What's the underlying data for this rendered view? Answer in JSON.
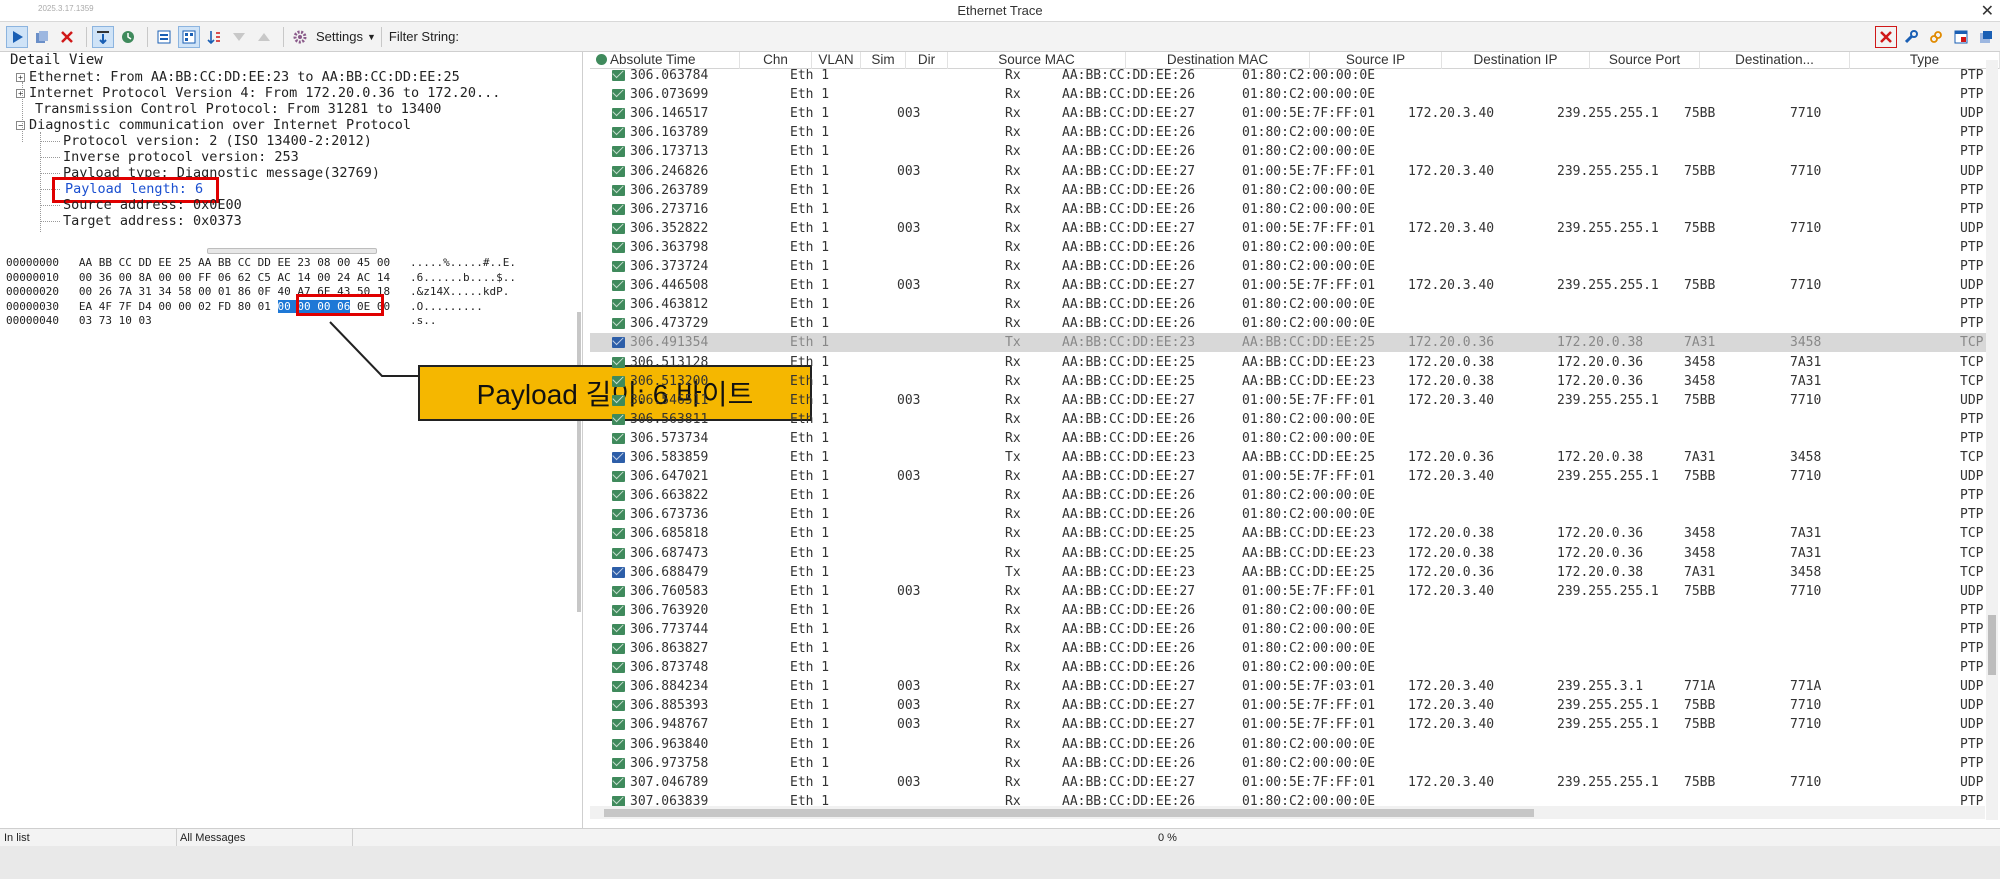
{
  "window": {
    "version": "2025.3.17.1359",
    "title": "Ethernet Trace",
    "close_glyph": "✕"
  },
  "toolbar": {
    "settings_label": "Settings",
    "filter_label": "Filter String:"
  },
  "detail": {
    "header": "Detail View",
    "lines": [
      "Ethernet: From AA:BB:CC:DD:EE:23 to AA:BB:CC:DD:EE:25",
      "Internet Protocol Version 4: From 172.20.0.36 to 172.20...",
      "Transmission Control Protocol: From 31281 to 13400",
      "Diagnostic communication over Internet Protocol",
      "Protocol version: 2 (ISO 13400-2:2012)",
      "Inverse protocol version: 253",
      "Payload type: Diagnostic message(32769)",
      "Payload length: 6",
      "Source address: 0x0E00",
      "Target address: 0x0373"
    ]
  },
  "hex": {
    "rows": [
      {
        "offset": "00000000",
        "bytes": "AA BB CC DD EE 25 AA BB CC DD EE 23 08 00 45 00",
        "ascii": ".....%.....#..E."
      },
      {
        "offset": "00000010",
        "bytes": "00 36 00 8A 00 00 FF 06 62 C5 AC 14 00 24 AC 14",
        "ascii": ".6......b....$.."
      },
      {
        "offset": "00000020",
        "bytes": "00 26 7A 31 34 58 00 01 86 0F 40 A7 6E 43 50 18",
        "ascii": ".&z14X.....kdP."
      },
      {
        "offset": "00000030",
        "bytes_pre": "EA 4F 7F D4 00 00 02 FD 80 01 ",
        "bytes_sel": "00 00 00 06",
        "bytes_post": " 0E 00",
        "ascii": ".O........."
      },
      {
        "offset": "00000040",
        "bytes": "03 73 10 03",
        "ascii": ".s.."
      }
    ]
  },
  "callout": {
    "text": "Payload 길이: 6 바이트"
  },
  "colors": {
    "rx_icon": "#3f8a5c",
    "tx_icon": "#2d5ea8",
    "highlight_red": "#e00000",
    "callout_bg": "#f5b700"
  },
  "table": {
    "columns": [
      "Absolute Time",
      "Chn",
      "VLAN",
      "Sim",
      "Dir",
      "Source MAC",
      "Destination MAC",
      "Source IP",
      "Destination IP",
      "Source Port",
      "Destination...",
      "Type"
    ],
    "rows": [
      [
        "306.063784",
        "Eth 1",
        "",
        "",
        "Rx",
        "AA:BB:CC:DD:EE:26",
        "01:80:C2:00:00:0E",
        "",
        "",
        "",
        "",
        "PTP"
      ],
      [
        "306.073699",
        "Eth 1",
        "",
        "",
        "Rx",
        "AA:BB:CC:DD:EE:26",
        "01:80:C2:00:00:0E",
        "",
        "",
        "",
        "",
        "PTP"
      ],
      [
        "306.146517",
        "Eth 1",
        "003",
        "",
        "Rx",
        "AA:BB:CC:DD:EE:27",
        "01:00:5E:7F:FF:01",
        "172.20.3.40",
        "239.255.255.1",
        "75BB",
        "7710",
        "UDP"
      ],
      [
        "306.163789",
        "Eth 1",
        "",
        "",
        "Rx",
        "AA:BB:CC:DD:EE:26",
        "01:80:C2:00:00:0E",
        "",
        "",
        "",
        "",
        "PTP"
      ],
      [
        "306.173713",
        "Eth 1",
        "",
        "",
        "Rx",
        "AA:BB:CC:DD:EE:26",
        "01:80:C2:00:00:0E",
        "",
        "",
        "",
        "",
        "PTP"
      ],
      [
        "306.246826",
        "Eth 1",
        "003",
        "",
        "Rx",
        "AA:BB:CC:DD:EE:27",
        "01:00:5E:7F:FF:01",
        "172.20.3.40",
        "239.255.255.1",
        "75BB",
        "7710",
        "UDP"
      ],
      [
        "306.263789",
        "Eth 1",
        "",
        "",
        "Rx",
        "AA:BB:CC:DD:EE:26",
        "01:80:C2:00:00:0E",
        "",
        "",
        "",
        "",
        "PTP"
      ],
      [
        "306.273716",
        "Eth 1",
        "",
        "",
        "Rx",
        "AA:BB:CC:DD:EE:26",
        "01:80:C2:00:00:0E",
        "",
        "",
        "",
        "",
        "PTP"
      ],
      [
        "306.352822",
        "Eth 1",
        "003",
        "",
        "Rx",
        "AA:BB:CC:DD:EE:27",
        "01:00:5E:7F:FF:01",
        "172.20.3.40",
        "239.255.255.1",
        "75BB",
        "7710",
        "UDP"
      ],
      [
        "306.363798",
        "Eth 1",
        "",
        "",
        "Rx",
        "AA:BB:CC:DD:EE:26",
        "01:80:C2:00:00:0E",
        "",
        "",
        "",
        "",
        "PTP"
      ],
      [
        "306.373724",
        "Eth 1",
        "",
        "",
        "Rx",
        "AA:BB:CC:DD:EE:26",
        "01:80:C2:00:00:0E",
        "",
        "",
        "",
        "",
        "PTP"
      ],
      [
        "306.446508",
        "Eth 1",
        "003",
        "",
        "Rx",
        "AA:BB:CC:DD:EE:27",
        "01:00:5E:7F:FF:01",
        "172.20.3.40",
        "239.255.255.1",
        "75BB",
        "7710",
        "UDP"
      ],
      [
        "306.463812",
        "Eth 1",
        "",
        "",
        "Rx",
        "AA:BB:CC:DD:EE:26",
        "01:80:C2:00:00:0E",
        "",
        "",
        "",
        "",
        "PTP"
      ],
      [
        "306.473729",
        "Eth 1",
        "",
        "",
        "Rx",
        "AA:BB:CC:DD:EE:26",
        "01:80:C2:00:00:0E",
        "",
        "",
        "",
        "",
        "PTP"
      ],
      [
        "306.491354",
        "Eth 1",
        "",
        "",
        "Tx",
        "AA:BB:CC:DD:EE:23",
        "AA:BB:CC:DD:EE:25",
        "172.20.0.36",
        "172.20.0.38",
        "7A31",
        "3458",
        "TCP"
      ],
      [
        "306.513128",
        "Eth 1",
        "",
        "",
        "Rx",
        "AA:BB:CC:DD:EE:25",
        "AA:BB:CC:DD:EE:23",
        "172.20.0.38",
        "172.20.0.36",
        "3458",
        "7A31",
        "TCP"
      ],
      [
        "306.513200",
        "Eth 1",
        "",
        "",
        "Rx",
        "AA:BB:CC:DD:EE:25",
        "AA:BB:CC:DD:EE:23",
        "172.20.0.38",
        "172.20.0.36",
        "3458",
        "7A31",
        "TCP"
      ],
      [
        "306.546511",
        "Eth 1",
        "003",
        "",
        "Rx",
        "AA:BB:CC:DD:EE:27",
        "01:00:5E:7F:FF:01",
        "172.20.3.40",
        "239.255.255.1",
        "75BB",
        "7710",
        "UDP"
      ],
      [
        "306.563811",
        "Eth 1",
        "",
        "",
        "Rx",
        "AA:BB:CC:DD:EE:26",
        "01:80:C2:00:00:0E",
        "",
        "",
        "",
        "",
        "PTP"
      ],
      [
        "306.573734",
        "Eth 1",
        "",
        "",
        "Rx",
        "AA:BB:CC:DD:EE:26",
        "01:80:C2:00:00:0E",
        "",
        "",
        "",
        "",
        "PTP"
      ],
      [
        "306.583859",
        "Eth 1",
        "",
        "",
        "Tx",
        "AA:BB:CC:DD:EE:23",
        "AA:BB:CC:DD:EE:25",
        "172.20.0.36",
        "172.20.0.38",
        "7A31",
        "3458",
        "TCP"
      ],
      [
        "306.647021",
        "Eth 1",
        "003",
        "",
        "Rx",
        "AA:BB:CC:DD:EE:27",
        "01:00:5E:7F:FF:01",
        "172.20.3.40",
        "239.255.255.1",
        "75BB",
        "7710",
        "UDP"
      ],
      [
        "306.663822",
        "Eth 1",
        "",
        "",
        "Rx",
        "AA:BB:CC:DD:EE:26",
        "01:80:C2:00:00:0E",
        "",
        "",
        "",
        "",
        "PTP"
      ],
      [
        "306.673736",
        "Eth 1",
        "",
        "",
        "Rx",
        "AA:BB:CC:DD:EE:26",
        "01:80:C2:00:00:0E",
        "",
        "",
        "",
        "",
        "PTP"
      ],
      [
        "306.685818",
        "Eth 1",
        "",
        "",
        "Rx",
        "AA:BB:CC:DD:EE:25",
        "AA:BB:CC:DD:EE:23",
        "172.20.0.38",
        "172.20.0.36",
        "3458",
        "7A31",
        "TCP"
      ],
      [
        "306.687473",
        "Eth 1",
        "",
        "",
        "Rx",
        "AA:BB:CC:DD:EE:25",
        "AA:BB:CC:DD:EE:23",
        "172.20.0.38",
        "172.20.0.36",
        "3458",
        "7A31",
        "TCP"
      ],
      [
        "306.688479",
        "Eth 1",
        "",
        "",
        "Tx",
        "AA:BB:CC:DD:EE:23",
        "AA:BB:CC:DD:EE:25",
        "172.20.0.36",
        "172.20.0.38",
        "7A31",
        "3458",
        "TCP"
      ],
      [
        "306.760583",
        "Eth 1",
        "003",
        "",
        "Rx",
        "AA:BB:CC:DD:EE:27",
        "01:00:5E:7F:FF:01",
        "172.20.3.40",
        "239.255.255.1",
        "75BB",
        "7710",
        "UDP"
      ],
      [
        "306.763920",
        "Eth 1",
        "",
        "",
        "Rx",
        "AA:BB:CC:DD:EE:26",
        "01:80:C2:00:00:0E",
        "",
        "",
        "",
        "",
        "PTP"
      ],
      [
        "306.773744",
        "Eth 1",
        "",
        "",
        "Rx",
        "AA:BB:CC:DD:EE:26",
        "01:80:C2:00:00:0E",
        "",
        "",
        "",
        "",
        "PTP"
      ],
      [
        "306.863827",
        "Eth 1",
        "",
        "",
        "Rx",
        "AA:BB:CC:DD:EE:26",
        "01:80:C2:00:00:0E",
        "",
        "",
        "",
        "",
        "PTP"
      ],
      [
        "306.873748",
        "Eth 1",
        "",
        "",
        "Rx",
        "AA:BB:CC:DD:EE:26",
        "01:80:C2:00:00:0E",
        "",
        "",
        "",
        "",
        "PTP"
      ],
      [
        "306.884234",
        "Eth 1",
        "003",
        "",
        "Rx",
        "AA:BB:CC:DD:EE:27",
        "01:00:5E:7F:03:01",
        "172.20.3.40",
        "239.255.3.1",
        "771A",
        "771A",
        "UDP"
      ],
      [
        "306.885393",
        "Eth 1",
        "003",
        "",
        "Rx",
        "AA:BB:CC:DD:EE:27",
        "01:00:5E:7F:FF:01",
        "172.20.3.40",
        "239.255.255.1",
        "75BB",
        "7710",
        "UDP"
      ],
      [
        "306.948767",
        "Eth 1",
        "003",
        "",
        "Rx",
        "AA:BB:CC:DD:EE:27",
        "01:00:5E:7F:FF:01",
        "172.20.3.40",
        "239.255.255.1",
        "75BB",
        "7710",
        "UDP"
      ],
      [
        "306.963840",
        "Eth 1",
        "",
        "",
        "Rx",
        "AA:BB:CC:DD:EE:26",
        "01:80:C2:00:00:0E",
        "",
        "",
        "",
        "",
        "PTP"
      ],
      [
        "306.973758",
        "Eth 1",
        "",
        "",
        "Rx",
        "AA:BB:CC:DD:EE:26",
        "01:80:C2:00:00:0E",
        "",
        "",
        "",
        "",
        "PTP"
      ],
      [
        "307.046789",
        "Eth 1",
        "003",
        "",
        "Rx",
        "AA:BB:CC:DD:EE:27",
        "01:00:5E:7F:FF:01",
        "172.20.3.40",
        "239.255.255.1",
        "75BB",
        "7710",
        "UDP"
      ],
      [
        "307.063839",
        "Eth 1",
        "",
        "",
        "Rx",
        "AA:BB:CC:DD:EE:26",
        "01:80:C2:00:00:0E",
        "",
        "",
        "",
        "",
        "PTP"
      ]
    ],
    "selected_row": 14
  },
  "status": {
    "left": "In list",
    "filter": "All Messages",
    "progress": "0 %"
  }
}
